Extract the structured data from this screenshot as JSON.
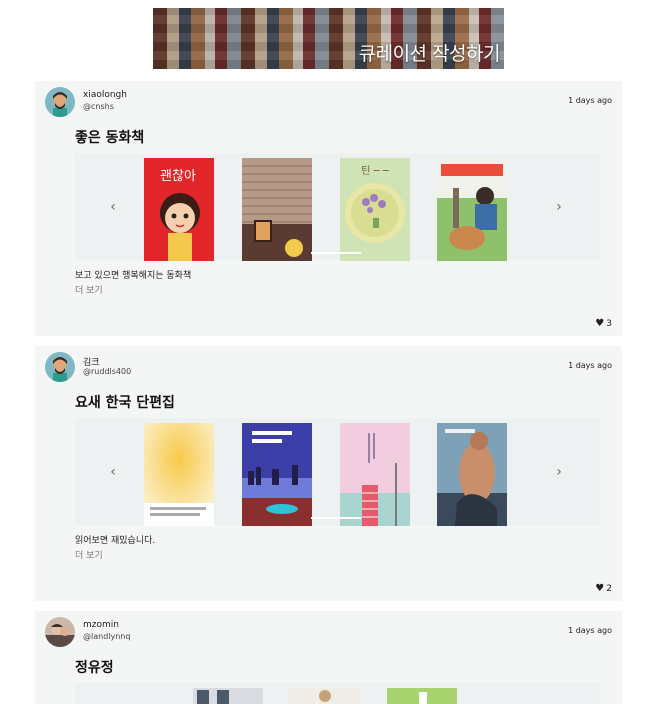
{
  "banner": {
    "label": "큐레이션 작성하기"
  },
  "posts": [
    {
      "username": "xiaolongh",
      "handle": "@cnshs",
      "time": "1 days ago",
      "title": "좋은 동화책",
      "book1_title": "괜찮아",
      "description": "보고 있으면 행복해지는 동화책",
      "more": "더 보기",
      "likes": "3"
    },
    {
      "username": "김크",
      "handle": "@ruddls400",
      "time": "1 days ago",
      "title": "요새 한국 단편집",
      "description": "읽어보면 재밌습니다.",
      "more": "더 보기",
      "likes": "2"
    },
    {
      "username": "mzomin",
      "handle": "@landlynnq",
      "time": "1 days ago",
      "title": "정유정"
    }
  ]
}
